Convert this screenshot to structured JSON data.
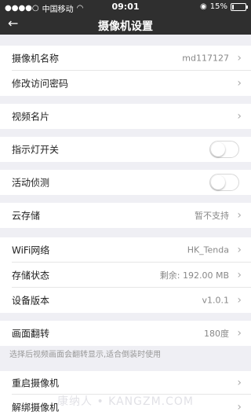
{
  "status_bar": {
    "carrier": "中国移动",
    "time": "09:01",
    "battery": "15%",
    "battery_level": 0.15
  },
  "nav": {
    "title": "摄像机设置",
    "back_icon": "arrow-left-icon"
  },
  "items": {
    "camera_name": {
      "label": "摄像机名称",
      "value": "md117127"
    },
    "change_password": {
      "label": "修改访问密码"
    },
    "video_clips": {
      "label": "视频名片"
    },
    "indicator_light": {
      "label": "指示灯开关",
      "on": false
    },
    "motion_detection": {
      "label": "活动侦测",
      "on": false
    },
    "cloud_storage": {
      "label": "云存储",
      "value": "暂不支持"
    },
    "wifi": {
      "label": "WiFi网络",
      "value": "HK_Tenda"
    },
    "storage_status": {
      "label": "存储状态",
      "value": "剩余: 192.00 MB"
    },
    "device_version": {
      "label": "设备版本",
      "value": "v1.0.1"
    },
    "image_flip": {
      "label": "画面翻转",
      "value": "180度"
    },
    "flip_note": "选择后视频画面会翻转显示,适合倒装时使用",
    "restart_camera": {
      "label": "重启摄像机"
    },
    "unbind_camera": {
      "label": "解绑摄像机"
    }
  },
  "watermark": "康纳人 • KANGZM.COM"
}
